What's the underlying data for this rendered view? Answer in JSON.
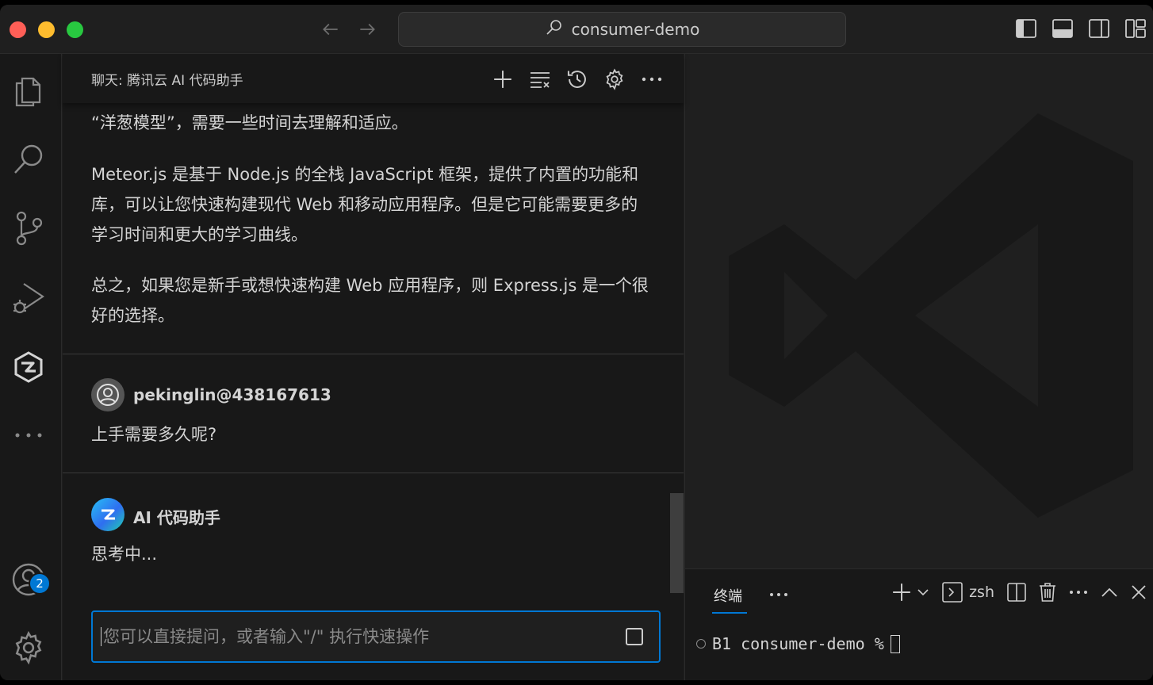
{
  "titlebar": {
    "search_text": "consumer-demo"
  },
  "activity": {
    "accounts_badge": "2"
  },
  "chat": {
    "title": "聊天: 腾讯云 AI 代码助手",
    "messages": [
      {
        "paragraphs": [
          "“洋葱模型”，需要一些时间去理解和适应。",
          "Meteor.js 是基于 Node.js 的全栈 JavaScript 框架，提供了内置的功能和库，可以让您快速构建现代 Web 和移动应用程序。但是它可能需要更多的学习时间和更大的学习曲线。",
          "总之，如果您是新手或想快速构建 Web 应用程序，则 Express.js 是一个很好的选择。"
        ]
      },
      {
        "author": "pekinglin@438167613",
        "text": "上手需要多久呢?"
      },
      {
        "author": "AI 代码助手",
        "text": "思考中..."
      }
    ],
    "input_placeholder": "您可以直接提问，或者输入\"/\" 执行快速操作"
  },
  "terminal": {
    "tab_label": "终端",
    "shell": "zsh",
    "prompt": "B1 consumer-demo %"
  },
  "colors": {
    "accent": "#0078d4",
    "bg": "#1f1f1f",
    "sidebar": "#181818"
  }
}
